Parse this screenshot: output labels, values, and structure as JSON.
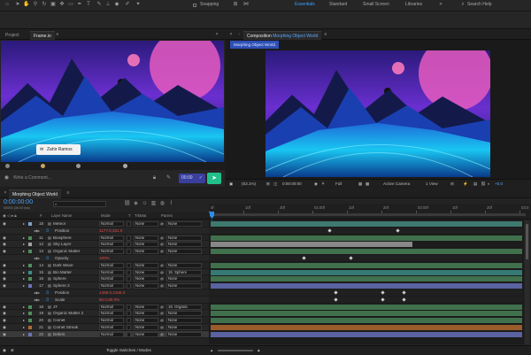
{
  "toolbar": {
    "snapping": "Snapping",
    "workspaces": [
      "Essentials",
      "Standard",
      "Small Screen",
      "Libraries"
    ],
    "active_workspace": "Essentials",
    "search_placeholder": "Search Help"
  },
  "left_panel": {
    "tabs": [
      "Project",
      "Frame.io"
    ],
    "active_tab": "Frame.io",
    "comment_placeholder": "Write a Comment...",
    "reviewer": "Zahir Ramos",
    "timecode": "00:00"
  },
  "comp_panel": {
    "tab_prefix": "Composition",
    "comp_name": "Morphing Object World",
    "sub_tab": "Morphing Object World",
    "footer": {
      "zoom": "(63.1%)",
      "time": "0:00:00:00",
      "resolution": "Full",
      "camera": "Active Camera",
      "view": "1 View",
      "exposure": "+0.0"
    }
  },
  "timeline": {
    "comp_tab": "Morphing Object World",
    "timecode": "0:00:00:00",
    "fps": "00000 (30.00 fps)",
    "columns": {
      "num": "#",
      "name": "Layer Name",
      "mode": "Mode",
      "t": "T",
      "trkmat": "TrkMat",
      "parent": "Parent"
    },
    "ruler": [
      "0f",
      "10f",
      "20f",
      "01:00f",
      "10f",
      "20f",
      "02:00f",
      "10f",
      "20f",
      "03:0"
    ],
    "footer": "Toggle Switches / Modes",
    "rows": [
      {
        "num": "18",
        "name": "Meteor",
        "mode": "Normal",
        "trk": "None",
        "parent": "None",
        "kind": "layer",
        "color": "#7aa2c8",
        "bar": "#3f7a6f",
        "bar_start": 0,
        "bar_end": 1.0
      },
      {
        "num": "",
        "name": "Position",
        "value": "1177.0,331.0",
        "kind": "prop",
        "kf": [
          0.38,
          0.6
        ]
      },
      {
        "num": "11",
        "name": "Biosphere",
        "mode": "Normal",
        "trk": "None",
        "parent": "None",
        "kind": "layer",
        "color": "#4f8f5a",
        "bar": "#41704c",
        "bar_start": 0,
        "bar_end": 1.0
      },
      {
        "num": "12",
        "name": "Sky Layer",
        "mode": "Normal",
        "trk": "None",
        "parent": "None",
        "kind": "layer",
        "color": "#a3a3a3",
        "bar": "#888888",
        "bar_start": 0,
        "bar_end": 0.65
      },
      {
        "num": "13",
        "name": "Organic Matter",
        "mode": "Normal",
        "trk": "None",
        "parent": "None",
        "kind": "layer",
        "color": "#4f8f5a",
        "bar": "#41704c",
        "bar_start": 0,
        "bar_end": 1.0
      },
      {
        "num": "",
        "name": "Opacity",
        "value": "100%",
        "kind": "prop",
        "kf": [
          0.3,
          0.45
        ]
      },
      {
        "num": "14",
        "name": "Dark Wave",
        "mode": "Normal",
        "trk": "None",
        "parent": "None",
        "kind": "layer",
        "color": "#4f8f5a",
        "bar": "#41704c",
        "bar_start": 0,
        "bar_end": 1.0
      },
      {
        "num": "15",
        "name": "Bio Matter",
        "mode": "Normal",
        "trk": "None",
        "parent": "16. Sphere",
        "kind": "layer",
        "color": "#3c8f8b",
        "bar": "#357a74",
        "bar_start": 0,
        "bar_end": 1.0
      },
      {
        "num": "16",
        "name": "Sphere",
        "mode": "Normal",
        "trk": "None",
        "parent": "None",
        "kind": "layer",
        "color": "#4f8f5a",
        "bar": "#41704c",
        "bar_start": 0,
        "bar_end": 1.0
      },
      {
        "num": "17",
        "name": "Sphere 2",
        "mode": "Normal",
        "trk": "None",
        "parent": "None",
        "kind": "layer",
        "color": "#6b74b8",
        "bar": "#5a63a0",
        "bar_start": 0,
        "bar_end": 1.0
      },
      {
        "num": "",
        "name": "Position",
        "value": "1469.0,2165.0",
        "kind": "prop",
        "kf": [
          0.4,
          0.55,
          0.62
        ]
      },
      {
        "num": "",
        "name": "Scale",
        "value": "80.0,80.0%",
        "kind": "prop",
        "kf": [
          0.4,
          0.55,
          0.62
        ]
      },
      {
        "num": "18",
        "name": "JT",
        "mode": "Normal",
        "trk": "None",
        "parent": "19. Organic",
        "kind": "layer",
        "color": "#4f8f5a",
        "bar": "#41704c",
        "bar_start": 0,
        "bar_end": 1.0
      },
      {
        "num": "19",
        "name": "Organic Matter 2",
        "mode": "Normal",
        "trk": "None",
        "parent": "None",
        "kind": "layer",
        "color": "#4f8f5a",
        "bar": "#41704c",
        "bar_start": 0,
        "bar_end": 1.0
      },
      {
        "num": "20",
        "name": "Comet",
        "mode": "Normal",
        "trk": "None",
        "parent": "None",
        "kind": "layer",
        "color": "#4f8f5a",
        "bar": "#41704c",
        "bar_start": 0,
        "bar_end": 1.0
      },
      {
        "num": "21",
        "name": "Comet Streak",
        "mode": "Normal",
        "trk": "None",
        "parent": "None",
        "kind": "layer",
        "color": "#b06a2e",
        "bar": "#9a5c2a",
        "bar_start": 0,
        "bar_end": 1.0
      },
      {
        "num": "22",
        "name": "Debris",
        "mode": "Normal",
        "trk": "None",
        "parent": "None",
        "kind": "layer",
        "color": "#6b74b8",
        "bar": "#5a63a0",
        "bar_start": 0,
        "bar_end": 1.0,
        "selected": true
      }
    ]
  },
  "colors": {
    "accent": "#2d8ceb",
    "green": "#21c08b",
    "timecode": "#4fa3f5"
  }
}
